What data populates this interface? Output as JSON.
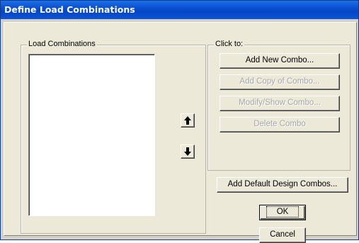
{
  "window": {
    "title": "Define Load Combinations"
  },
  "load_combinations": {
    "legend": "Load Combinations",
    "items": []
  },
  "click_to": {
    "legend": "Click to:",
    "add_new_label": "Add New Combo...",
    "add_copy_label": "Add Copy of Combo...",
    "modify_show_label": "Modify/Show Combo...",
    "delete_label": "Delete Combo"
  },
  "buttons": {
    "add_default_label": "Add Default Design Combos...",
    "ok_label": "OK",
    "cancel_label": "Cancel"
  },
  "icons": {
    "move_up": "arrow-up-icon",
    "move_down": "arrow-down-icon"
  },
  "colors": {
    "titlebar": "#0a4fd1",
    "dialog_face": "#ece9d8",
    "disabled_text": "#a7a6aa"
  }
}
